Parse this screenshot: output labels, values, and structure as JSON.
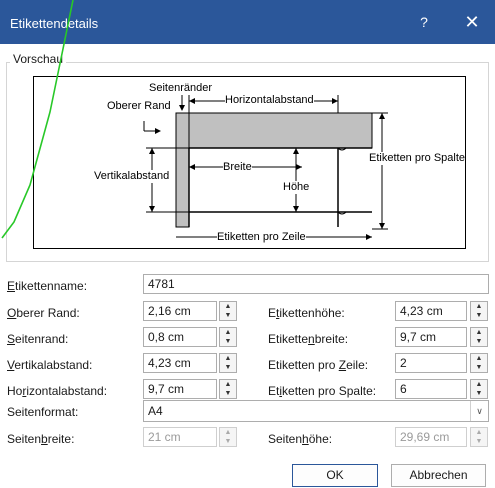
{
  "window": {
    "title": "Etikettendetails",
    "help_glyph": "?",
    "close_glyph": "✕",
    "accent": "#2b579a"
  },
  "preview": {
    "group_label": "Vorschau",
    "labels": {
      "seitenraender": "Seitenränder",
      "oberer_rand": "Oberer Rand",
      "horizontalabstand": "Horizontalabstand",
      "etiketten_pro_spalte": "Etiketten pro Spalte",
      "breite": "Breite",
      "vertikalabstand": "Vertikalabstand",
      "hoehe": "Höhe",
      "etiketten_pro_zeile": "Etiketten pro Zeile"
    }
  },
  "form": {
    "etikettenname": {
      "label": "Etikettenname:",
      "mnemonic": "E",
      "rest": "tikettenname:",
      "value": "4781"
    },
    "oberer_rand": {
      "pre": "",
      "mnemonic": "O",
      "rest": "berer Rand:",
      "value": "2,16 cm"
    },
    "seitenrand": {
      "pre": "",
      "mnemonic": "S",
      "rest": "eitenrand:",
      "value": "0,8 cm"
    },
    "vertikalabstand": {
      "pre": "",
      "mnemonic": "V",
      "rest": "ertikalabstand:",
      "value": "4,23 cm"
    },
    "horizontalabstand": {
      "pre": "Ho",
      "mnemonic": "r",
      "rest": "izontalabstand:",
      "value": "9,7 cm"
    },
    "etikettenhoehe": {
      "pre": "E",
      "mnemonic": "t",
      "rest": "ikettenhöhe:",
      "value": "4,23 cm"
    },
    "etikettenbreite": {
      "pre": "Etikette",
      "mnemonic": "n",
      "rest": "breite:",
      "value": "9,7 cm"
    },
    "etiketten_pro_zeile": {
      "pre": "Etiketten pro ",
      "mnemonic": "Z",
      "rest": "eile:",
      "value": "2"
    },
    "etiketten_pro_spalte": {
      "pre": "Et",
      "mnemonic": "i",
      "rest": "ketten pro Spalte:",
      "value": "6"
    },
    "seitenformat": {
      "label": "Seitenformat:",
      "value": "A4"
    },
    "seitenbreite": {
      "pre": "Seiten",
      "mnemonic": "b",
      "rest": "reite:",
      "value": "21 cm"
    },
    "seitenhoehe": {
      "pre": "Seiten",
      "mnemonic": "h",
      "rest": "öhe:",
      "value": "29,69 cm"
    }
  },
  "buttons": {
    "ok": "OK",
    "cancel": "Abbrechen"
  }
}
